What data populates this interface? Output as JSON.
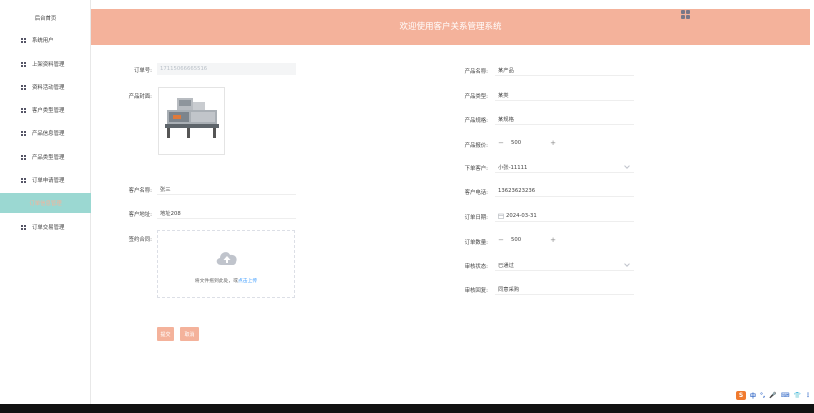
{
  "sidebar": {
    "home": "后台首页",
    "items": [
      {
        "label": "系统用户"
      },
      {
        "label": "上架资料管理"
      },
      {
        "label": "资料活动管理"
      },
      {
        "label": "客户类型管理"
      },
      {
        "label": "产品信息管理"
      },
      {
        "label": "产品类型管理"
      },
      {
        "label": "订单申请管理"
      },
      {
        "label": "订单信息管理"
      },
      {
        "label": "订单交易管理"
      }
    ],
    "active_index": 7
  },
  "header": {
    "title": "欢迎使用客户关系管理系统",
    "logo_icon": "app-logo-icon"
  },
  "form": {
    "order_no": {
      "label": "订单号:",
      "value": "17115066665516"
    },
    "product_image": {
      "label": "产品封面:"
    },
    "customer_name": {
      "label": "客户名称:",
      "value": "张三"
    },
    "customer_address": {
      "label": "客户地址:",
      "value": "地址208"
    },
    "contract": {
      "label": "签约合同:",
      "upload_text": "将文件拖到此处，或",
      "upload_link": "点击上传",
      "icon": "upload-cloud-icon"
    },
    "product_name": {
      "label": "产品名称:",
      "value": "某产品"
    },
    "product_type": {
      "label": "产品类型:",
      "value": "某类"
    },
    "product_spec": {
      "label": "产品规格:",
      "value": "某规格"
    },
    "product_price": {
      "label": "产品报价:",
      "value": "500",
      "minus": "−",
      "plus": "+"
    },
    "order_customer": {
      "label": "下单客户:",
      "value": "小张-11111"
    },
    "customer_phone": {
      "label": "客户电话:",
      "value": "13623623236"
    },
    "order_date": {
      "label": "订单日期:",
      "value": "2024-03-31",
      "icon": "calendar-icon"
    },
    "order_quantity": {
      "label": "订单数量:",
      "value": "500",
      "minus": "−",
      "plus": "+"
    },
    "audit_status": {
      "label": "审核状态:",
      "value": "已通过"
    },
    "audit_reply": {
      "label": "审核回复:",
      "value": "同意采购"
    }
  },
  "buttons": {
    "submit": "提交",
    "cancel": "取消"
  },
  "colors": {
    "accent": "#f4b29b",
    "active_menu_bg": "#9bd8d2",
    "link": "#409eff"
  },
  "tray": {
    "ime_icon": "sogou-ime-icon",
    "items": [
      "中",
      "°,",
      "🎤",
      "⌨",
      "👕",
      "⋮"
    ]
  }
}
